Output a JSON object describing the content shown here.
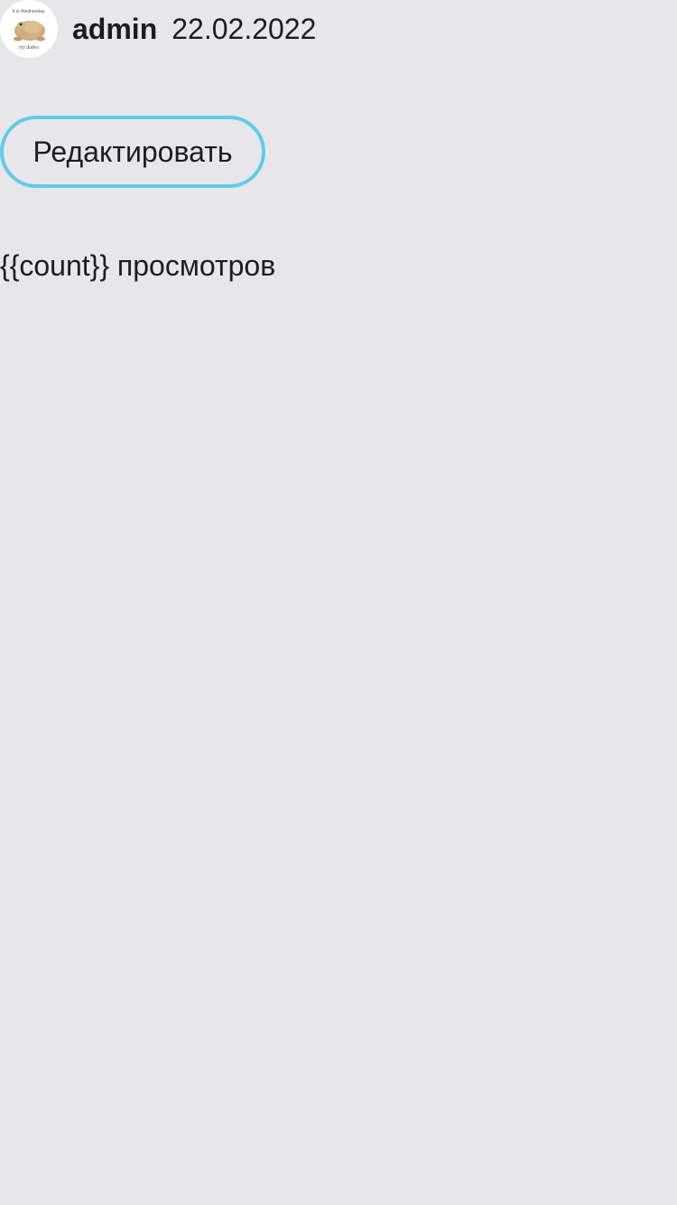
{
  "post": {
    "author": "admin",
    "date": "22.02.2022",
    "avatar": {
      "caption_top": "It is Wednesday,",
      "caption_bottom": "my dudes"
    }
  },
  "actions": {
    "edit_label": "Редактировать",
    "accent_color": "#5ccdec"
  },
  "stats": {
    "views_text": "{{count}} просмотров"
  },
  "colors": {
    "background": "#e7e7e9",
    "text": "#1b1d1f"
  }
}
